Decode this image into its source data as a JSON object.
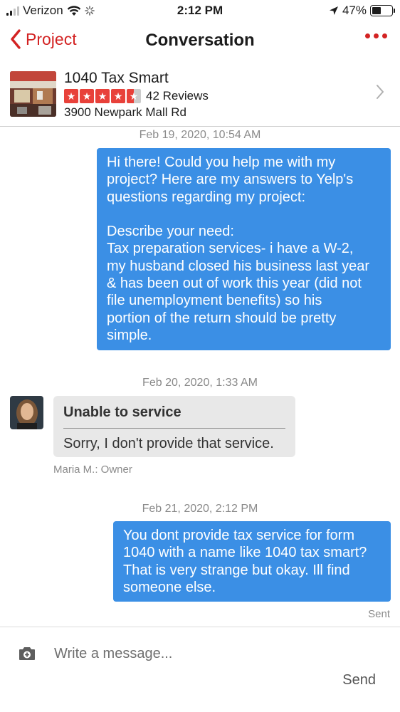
{
  "status_bar": {
    "carrier": "Verizon",
    "time": "2:12 PM",
    "battery_pct": "47%",
    "battery_level": 0.47
  },
  "nav": {
    "back_label": "Project",
    "title": "Conversation"
  },
  "business": {
    "name": "1040 Tax Smart",
    "rating": 4.5,
    "reviews_label": "42 Reviews",
    "address": "3900 Newpark Mall Rd"
  },
  "messages": [
    {
      "timestamp": "Feb 19, 2020, 10:54 AM",
      "text": "Hi there! Could you help me with my\nproject? Here are my answers to Yelp's\nquestions regarding my project:\n\nDescribe your need:\nTax preparation services- i have a W-2,\nmy husband closed his business last year\n& has been out of work this year (did not\nfile unemployment benefits) so his\nportion of the return should be pretty\nsimple."
    },
    {
      "timestamp": "Feb 20, 2020, 1:33 AM",
      "title": "Unable to service",
      "text": "Sorry, I don't provide that service.",
      "sender": "Maria M.: Owner"
    },
    {
      "timestamp": "Feb 21, 2020, 2:12 PM",
      "text": "You dont provide tax service for form\n1040 with a name like 1040 tax smart?\nThat is very strange but okay. Ill find\nsomeone else.",
      "status": "Sent"
    }
  ],
  "composer": {
    "placeholder": "Write a message...",
    "send_label": "Send"
  },
  "colors": {
    "brand_red": "#d32323",
    "outgoing_bubble": "#3b8fe5",
    "incoming_bubble": "#e8e8e8"
  }
}
